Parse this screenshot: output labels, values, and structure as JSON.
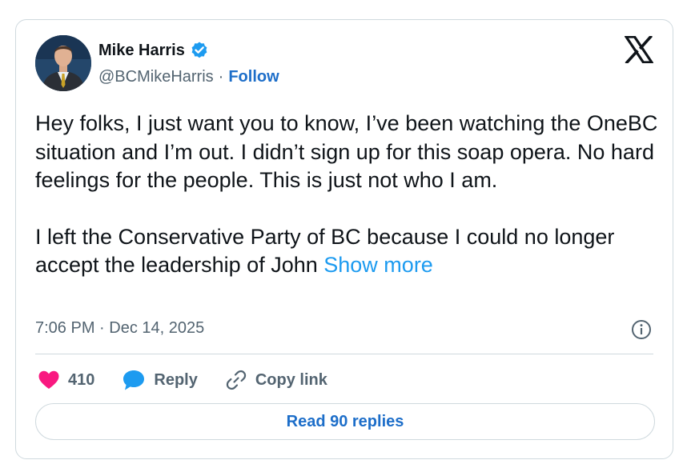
{
  "author": {
    "name": "Mike Harris",
    "handle": "@BCMikeHarris",
    "separator": "·",
    "follow_label": "Follow"
  },
  "tweet": {
    "paragraph1": "Hey folks, I just want you to know, I’ve been watching the OneBC situation and I’m out. I didn’t sign up for this soap opera. No hard feelings for the people. This is just not who I am.",
    "paragraph2": "I left the Conservative Party of BC because I could no longer accept the leadership of John",
    "show_more_label": "Show more",
    "timestamp": "7:06 PM · Dec 14, 2025"
  },
  "actions": {
    "like_count": "410",
    "reply_label": "Reply",
    "copy_link_label": "Copy link"
  },
  "read_replies_label": "Read 90 replies",
  "icons": {
    "verified": "verified-badge-icon",
    "x_logo": "x-logo-icon",
    "info": "info-icon",
    "heart": "heart-icon",
    "reply": "reply-bubble-icon",
    "link": "link-icon"
  },
  "colors": {
    "link_blue": "#1d6ec9",
    "show_more_blue": "#1d9bf0",
    "heart_pink": "#f91880",
    "verified_blue": "#1d9bf0",
    "secondary_text": "#536471",
    "border": "#cfd9de"
  }
}
